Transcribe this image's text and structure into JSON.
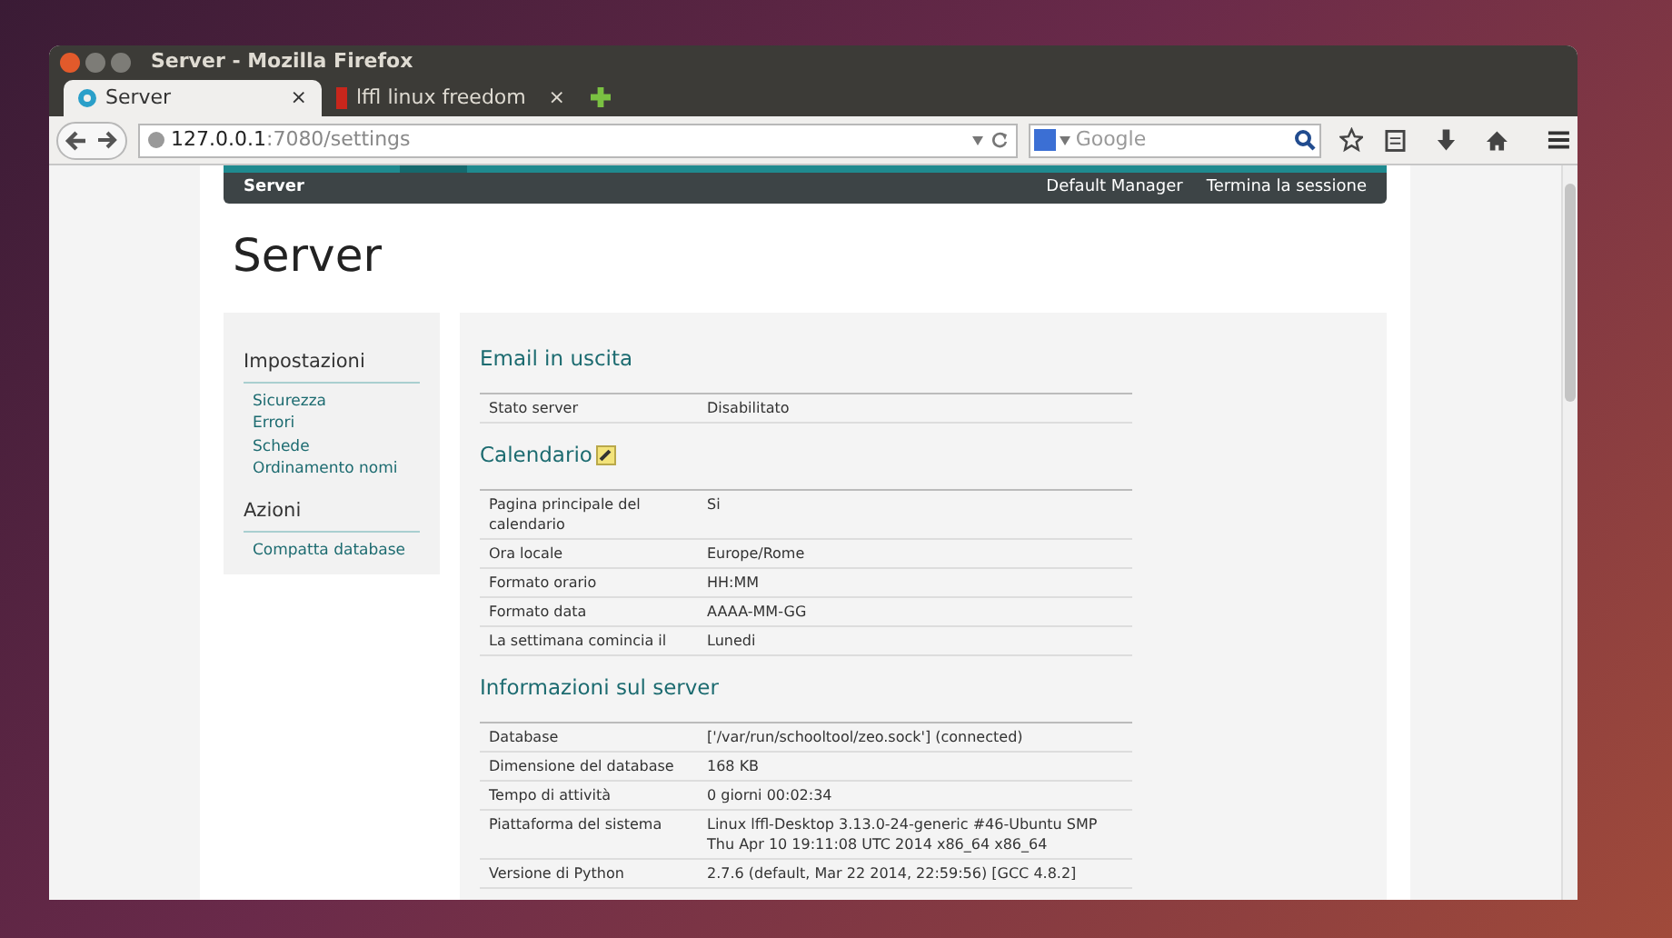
{
  "window": {
    "title": "Server - Mozilla Firefox"
  },
  "tabs": [
    {
      "label": "Server",
      "selected": true,
      "close": "×"
    },
    {
      "label": "lffl linux freedom",
      "selected": false,
      "close": "×"
    }
  ],
  "address_bar": {
    "host": "127.0.0.1",
    "path": ":7080/settings"
  },
  "search": {
    "placeholder": "Google"
  },
  "top_bar": {
    "title": "Server",
    "links": [
      "Default Manager",
      "Termina la sessione"
    ]
  },
  "page_title": "Server",
  "sidebar": {
    "sections": [
      {
        "heading": "Impostazioni",
        "items": [
          "Sicurezza",
          "Errori",
          "Schede",
          "Ordinamento nomi"
        ]
      },
      {
        "heading": "Azioni",
        "items": [
          "Compatta database"
        ]
      }
    ]
  },
  "sections": [
    {
      "heading": "Email in uscita",
      "rows": [
        [
          "Stato server",
          "Disabilitato"
        ]
      ]
    },
    {
      "heading": "Calendario",
      "editable": true,
      "rows": [
        [
          "Pagina principale del calendario",
          "Si"
        ],
        [
          "Ora locale",
          "Europe/Rome"
        ],
        [
          "Formato orario",
          "HH:MM"
        ],
        [
          "Formato data",
          "AAAA-MM-GG"
        ],
        [
          "La settimana comincia il",
          "Lunedi"
        ]
      ]
    },
    {
      "heading": "Informazioni sul server",
      "rows": [
        [
          "Database",
          "['/var/run/schooltool/zeo.sock'] (connected)"
        ],
        [
          "Dimensione del database",
          "168 KB"
        ],
        [
          "Tempo di attività",
          "0 giorni 00:02:34"
        ],
        [
          "Piattaforma del sistema",
          "Linux lffl-Desktop 3.13.0-24-generic #46-Ubuntu SMP Thu Apr 10 19:11:08 UTC 2014 x86_64 x86_64"
        ],
        [
          "Versione di Python",
          "2.7.6 (default, Mar 22 2014, 22:59:56) [GCC 4.8.2]"
        ]
      ]
    }
  ]
}
